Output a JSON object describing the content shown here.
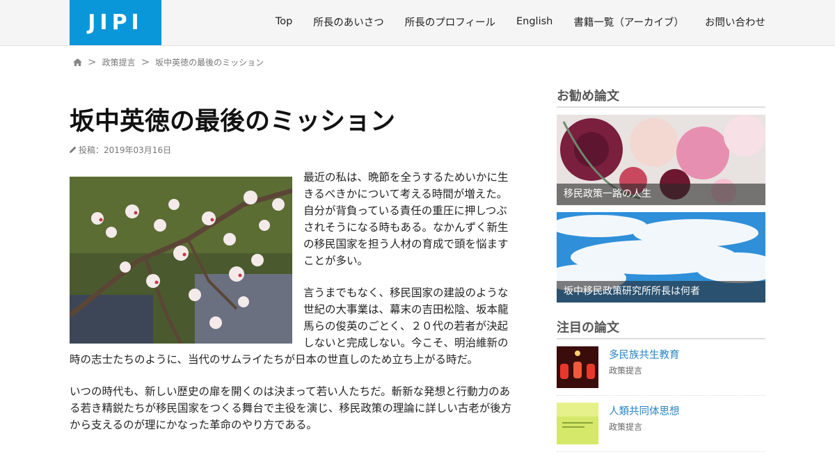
{
  "header": {
    "logo": "JIPI",
    "nav": [
      "Top",
      "所長のあいさつ",
      "所長のプロフィール",
      "English",
      "書籍一覧（アーカイブ）",
      "お問い合わせ"
    ]
  },
  "breadcrumb": {
    "items": [
      "政策提言",
      "坂中英徳の最後のミッション"
    ],
    "separator": ">"
  },
  "article": {
    "title": "坂中英徳の最後のミッション",
    "date": "投稿：2019年03月16日",
    "paragraphs": [
      "最近の私は、晩節を全うするためいかに生きるべきかについて考える時間が増えた。自分が背負っている責任の重圧に押しつぶされそうになる時もある。なかんずく新生の移民国家を担う人材の育成で頭を悩ますことが多い。",
      "言うまでもなく、移民国家の建設のような世紀の大事業は、幕末の吉田松陰、坂本龍馬らの俊英のごとく、２０代の若者が決起しないと完成しない。今こそ、明治維新の時の志士たちのように、当代のサムライたちが日本の世直しのため立ち上がる時だ。",
      "いつの時代も、新しい歴史の扉を開くのは決まって若い人たちだ。斬新な発想と行動力のある若き精鋭たちが移民国家をつくる舞台で主役を演じ、移民政策の理論に詳しい古老が後方から支えるのが理にかなった革命のやり方である。"
    ]
  },
  "sidebar": {
    "recommended_title": "お勧め論文",
    "recommended": [
      {
        "caption": "移民政策一路の人生"
      },
      {
        "caption": "坂中移民政策研究所所長は何者"
      }
    ],
    "featured_title": "注目の論文",
    "featured": [
      {
        "title": "多民族共生教育",
        "category": "政策提言"
      },
      {
        "title": "人類共同体思想",
        "category": "政策提言"
      }
    ]
  },
  "colors": {
    "logo_bg": "#0a97d9",
    "link": "#2a85c3"
  }
}
